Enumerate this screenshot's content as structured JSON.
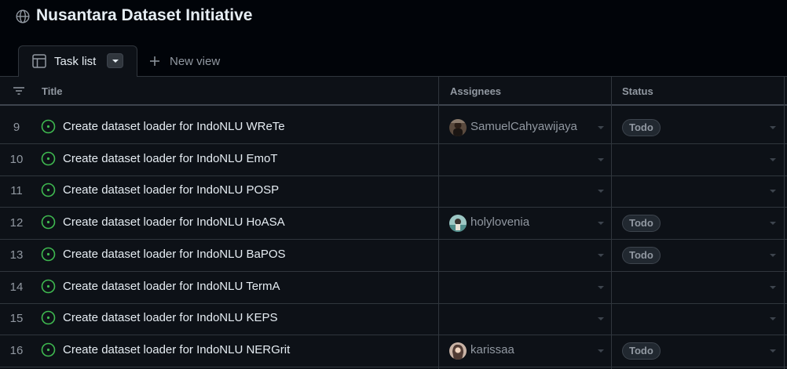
{
  "project": {
    "title": "Nusantara Dataset Initiative",
    "icon": "globe-icon"
  },
  "tabs": {
    "active": {
      "label": "Task list",
      "icon": "table-icon"
    },
    "new_view": {
      "label": "New view",
      "icon": "plus-icon"
    }
  },
  "columns": {
    "title": "Title",
    "assignees": "Assignees",
    "status": "Status"
  },
  "colors": {
    "background": "#010409",
    "surface": "#0d1117",
    "border": "#30363d",
    "text": "#e6edf3",
    "muted": "#9198a1",
    "open_issue": "#3fb950"
  },
  "rows": [
    {
      "num": "9",
      "title": "Create dataset loader for IndoNLU WReTe",
      "assignee": "SamuelCahyawijaya",
      "status": "Todo"
    },
    {
      "num": "10",
      "title": "Create dataset loader for IndoNLU EmoT",
      "assignee": "",
      "status": ""
    },
    {
      "num": "11",
      "title": "Create dataset loader for IndoNLU POSP",
      "assignee": "",
      "status": ""
    },
    {
      "num": "12",
      "title": "Create dataset loader for IndoNLU HoASA",
      "assignee": "holylovenia",
      "status": "Todo"
    },
    {
      "num": "13",
      "title": "Create dataset loader for IndoNLU BaPOS",
      "assignee": "",
      "status": "Todo"
    },
    {
      "num": "14",
      "title": "Create dataset loader for IndoNLU TermA",
      "assignee": "",
      "status": ""
    },
    {
      "num": "15",
      "title": "Create dataset loader for IndoNLU KEPS",
      "assignee": "",
      "status": ""
    },
    {
      "num": "16",
      "title": "Create dataset loader for IndoNLU NERGrit",
      "assignee": "karissaa",
      "status": "Todo"
    }
  ]
}
